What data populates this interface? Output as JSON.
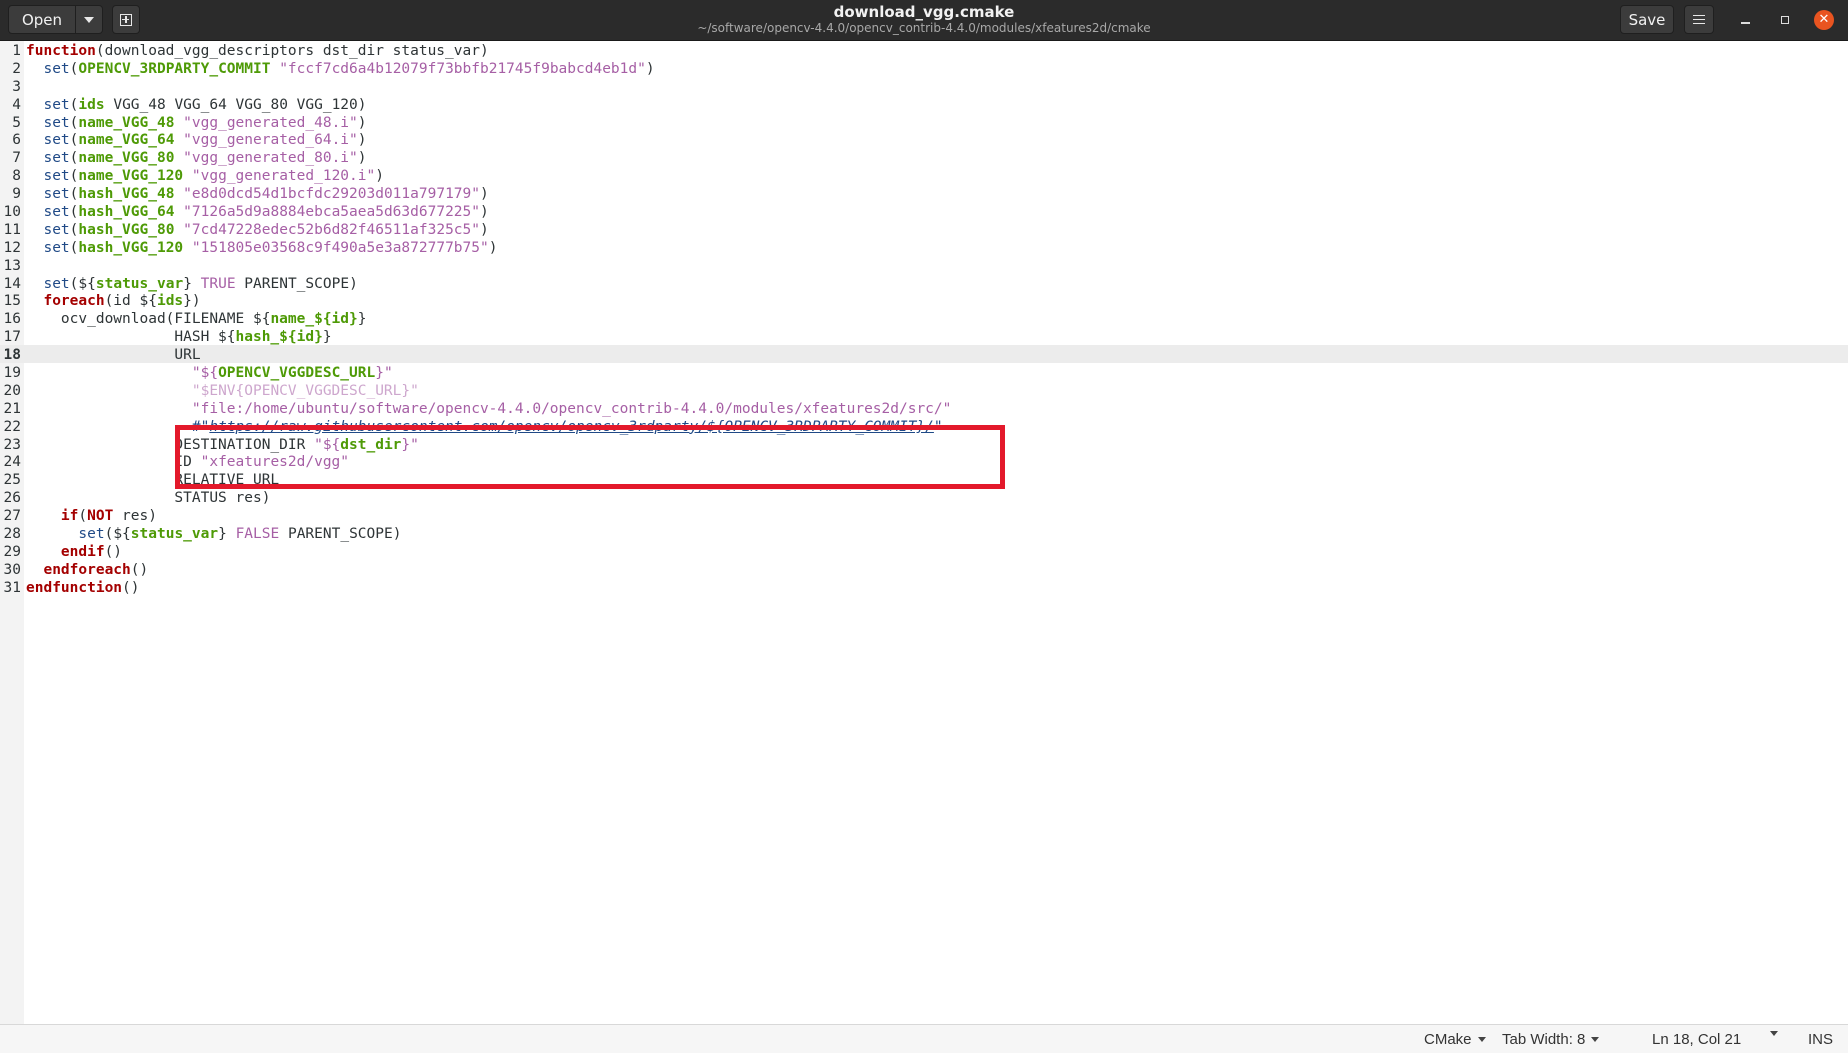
{
  "window": {
    "title": "download_vgg.cmake",
    "subtitle": "~/software/opencv-4.4.0/opencv_contrib-4.4.0/modules/xfeatures2d/cmake"
  },
  "toolbar": {
    "open_label": "Open",
    "save_label": "Save"
  },
  "icons": {
    "open_menu": "chevron-down-icon",
    "new_tab": "new-document-icon",
    "menu": "hamburger-icon",
    "minimize": "minimize-icon",
    "maximize": "maximize-icon",
    "close": "close-icon"
  },
  "editor": {
    "current_line": 18,
    "lines": [
      [
        {
          "t": "kw",
          "v": "function"
        },
        {
          "t": "p",
          "v": "(download_vgg_descriptors dst_dir status_var)"
        }
      ],
      [
        {
          "t": "p",
          "v": "  "
        },
        {
          "t": "fn",
          "v": "set"
        },
        {
          "t": "p",
          "v": "("
        },
        {
          "t": "var",
          "v": "OPENCV_3RDPARTY_COMMIT"
        },
        {
          "t": "p",
          "v": " "
        },
        {
          "t": "str",
          "v": "\"fccf7cd6a4b12079f73bbfb21745f9babcd4eb1d\""
        },
        {
          "t": "p",
          "v": ")"
        }
      ],
      [
        {
          "t": "p",
          "v": ""
        }
      ],
      [
        {
          "t": "p",
          "v": "  "
        },
        {
          "t": "fn",
          "v": "set"
        },
        {
          "t": "p",
          "v": "("
        },
        {
          "t": "var",
          "v": "ids"
        },
        {
          "t": "p",
          "v": " VGG_48 VGG_64 VGG_80 VGG_120)"
        }
      ],
      [
        {
          "t": "p",
          "v": "  "
        },
        {
          "t": "fn",
          "v": "set"
        },
        {
          "t": "p",
          "v": "("
        },
        {
          "t": "var",
          "v": "name_VGG_48"
        },
        {
          "t": "p",
          "v": " "
        },
        {
          "t": "str",
          "v": "\"vgg_generated_48.i\""
        },
        {
          "t": "p",
          "v": ")"
        }
      ],
      [
        {
          "t": "p",
          "v": "  "
        },
        {
          "t": "fn",
          "v": "set"
        },
        {
          "t": "p",
          "v": "("
        },
        {
          "t": "var",
          "v": "name_VGG_64"
        },
        {
          "t": "p",
          "v": " "
        },
        {
          "t": "str",
          "v": "\"vgg_generated_64.i\""
        },
        {
          "t": "p",
          "v": ")"
        }
      ],
      [
        {
          "t": "p",
          "v": "  "
        },
        {
          "t": "fn",
          "v": "set"
        },
        {
          "t": "p",
          "v": "("
        },
        {
          "t": "var",
          "v": "name_VGG_80"
        },
        {
          "t": "p",
          "v": " "
        },
        {
          "t": "str",
          "v": "\"vgg_generated_80.i\""
        },
        {
          "t": "p",
          "v": ")"
        }
      ],
      [
        {
          "t": "p",
          "v": "  "
        },
        {
          "t": "fn",
          "v": "set"
        },
        {
          "t": "p",
          "v": "("
        },
        {
          "t": "var",
          "v": "name_VGG_120"
        },
        {
          "t": "p",
          "v": " "
        },
        {
          "t": "str",
          "v": "\"vgg_generated_120.i\""
        },
        {
          "t": "p",
          "v": ")"
        }
      ],
      [
        {
          "t": "p",
          "v": "  "
        },
        {
          "t": "fn",
          "v": "set"
        },
        {
          "t": "p",
          "v": "("
        },
        {
          "t": "var",
          "v": "hash_VGG_48"
        },
        {
          "t": "p",
          "v": " "
        },
        {
          "t": "str",
          "v": "\"e8d0dcd54d1bcfdc29203d011a797179\""
        },
        {
          "t": "p",
          "v": ")"
        }
      ],
      [
        {
          "t": "p",
          "v": "  "
        },
        {
          "t": "fn",
          "v": "set"
        },
        {
          "t": "p",
          "v": "("
        },
        {
          "t": "var",
          "v": "hash_VGG_64"
        },
        {
          "t": "p",
          "v": " "
        },
        {
          "t": "str",
          "v": "\"7126a5d9a8884ebca5aea5d63d677225\""
        },
        {
          "t": "p",
          "v": ")"
        }
      ],
      [
        {
          "t": "p",
          "v": "  "
        },
        {
          "t": "fn",
          "v": "set"
        },
        {
          "t": "p",
          "v": "("
        },
        {
          "t": "var",
          "v": "hash_VGG_80"
        },
        {
          "t": "p",
          "v": " "
        },
        {
          "t": "str",
          "v": "\"7cd47228edec52b6d82f46511af325c5\""
        },
        {
          "t": "p",
          "v": ")"
        }
      ],
      [
        {
          "t": "p",
          "v": "  "
        },
        {
          "t": "fn",
          "v": "set"
        },
        {
          "t": "p",
          "v": "("
        },
        {
          "t": "var",
          "v": "hash_VGG_120"
        },
        {
          "t": "p",
          "v": " "
        },
        {
          "t": "str",
          "v": "\"151805e03568c9f490a5e3a872777b75\""
        },
        {
          "t": "p",
          "v": ")"
        }
      ],
      [
        {
          "t": "p",
          "v": ""
        }
      ],
      [
        {
          "t": "p",
          "v": "  "
        },
        {
          "t": "fn",
          "v": "set"
        },
        {
          "t": "p",
          "v": "(${"
        },
        {
          "t": "var",
          "v": "status_var"
        },
        {
          "t": "p",
          "v": "} "
        },
        {
          "t": "const",
          "v": "TRUE"
        },
        {
          "t": "p",
          "v": " PARENT_SCOPE)"
        }
      ],
      [
        {
          "t": "p",
          "v": "  "
        },
        {
          "t": "kw",
          "v": "foreach"
        },
        {
          "t": "p",
          "v": "(id ${"
        },
        {
          "t": "var",
          "v": "ids"
        },
        {
          "t": "p",
          "v": "})"
        }
      ],
      [
        {
          "t": "p",
          "v": "    ocv_download(FILENAME ${"
        },
        {
          "t": "var",
          "v": "name_${id}"
        },
        {
          "t": "p",
          "v": "}"
        }
      ],
      [
        {
          "t": "p",
          "v": "                 HASH ${"
        },
        {
          "t": "var",
          "v": "hash_${id}"
        },
        {
          "t": "p",
          "v": "}"
        }
      ],
      [
        {
          "t": "p",
          "v": "                 URL"
        }
      ],
      [
        {
          "t": "p",
          "v": "                   "
        },
        {
          "t": "str",
          "v": "\"${"
        },
        {
          "t": "var",
          "v": "OPENCV_VGGDESC_URL"
        },
        {
          "t": "str",
          "v": "}\""
        }
      ],
      [
        {
          "t": "p",
          "v": "                   "
        },
        {
          "t": "occ",
          "v": "\"$ENV{OPENCV_VGGDESC_URL}\""
        }
      ],
      [
        {
          "t": "p",
          "v": "                   "
        },
        {
          "t": "str",
          "v": "\"file:/home/ubuntu/software/opencv-4.4.0/opencv_contrib-4.4.0/modules/xfeatures2d/src/\""
        }
      ],
      [
        {
          "t": "p",
          "v": "                   "
        },
        {
          "t": "fn",
          "v": "#\""
        },
        {
          "t": "url",
          "v": "https://raw.githubusercontent.com/opencv/opencv_3rdparty/${OPENCV_3RDPARTY_COMMIT}/"
        },
        {
          "t": "fn",
          "v": "\""
        }
      ],
      [
        {
          "t": "p",
          "v": "                 DESTINATION_DIR "
        },
        {
          "t": "str",
          "v": "\"${"
        },
        {
          "t": "var",
          "v": "dst_dir"
        },
        {
          "t": "str",
          "v": "}\""
        }
      ],
      [
        {
          "t": "p",
          "v": "                 ID "
        },
        {
          "t": "str",
          "v": "\"xfeatures2d/vgg\""
        }
      ],
      [
        {
          "t": "p",
          "v": "                 RELATIVE_URL"
        }
      ],
      [
        {
          "t": "p",
          "v": "                 STATUS res)"
        }
      ],
      [
        {
          "t": "p",
          "v": "    "
        },
        {
          "t": "kw",
          "v": "if"
        },
        {
          "t": "p",
          "v": "("
        },
        {
          "t": "kw",
          "v": "NOT"
        },
        {
          "t": "p",
          "v": " res)"
        }
      ],
      [
        {
          "t": "p",
          "v": "      "
        },
        {
          "t": "fn",
          "v": "set"
        },
        {
          "t": "p",
          "v": "(${"
        },
        {
          "t": "var",
          "v": "status_var"
        },
        {
          "t": "p",
          "v": "} "
        },
        {
          "t": "const",
          "v": "FALSE"
        },
        {
          "t": "p",
          "v": " PARENT_SCOPE)"
        }
      ],
      [
        {
          "t": "p",
          "v": "    "
        },
        {
          "t": "kw",
          "v": "endif"
        },
        {
          "t": "p",
          "v": "()"
        }
      ],
      [
        {
          "t": "p",
          "v": "  "
        },
        {
          "t": "kw",
          "v": "endforeach"
        },
        {
          "t": "p",
          "v": "()"
        }
      ],
      [
        {
          "t": "kw",
          "v": "endfunction"
        },
        {
          "t": "p",
          "v": "()"
        }
      ]
    ]
  },
  "statusbar": {
    "language": "CMake",
    "tab_width": "Tab Width: 8",
    "position": "Ln 18, Col 21",
    "mode": "INS"
  },
  "colors": {
    "keyword": "#a40000",
    "function": "#204a87",
    "variable": "#4e9a06",
    "string": "#a65fa5",
    "highlight_box": "#e3192b",
    "close_button": "#e95420"
  }
}
